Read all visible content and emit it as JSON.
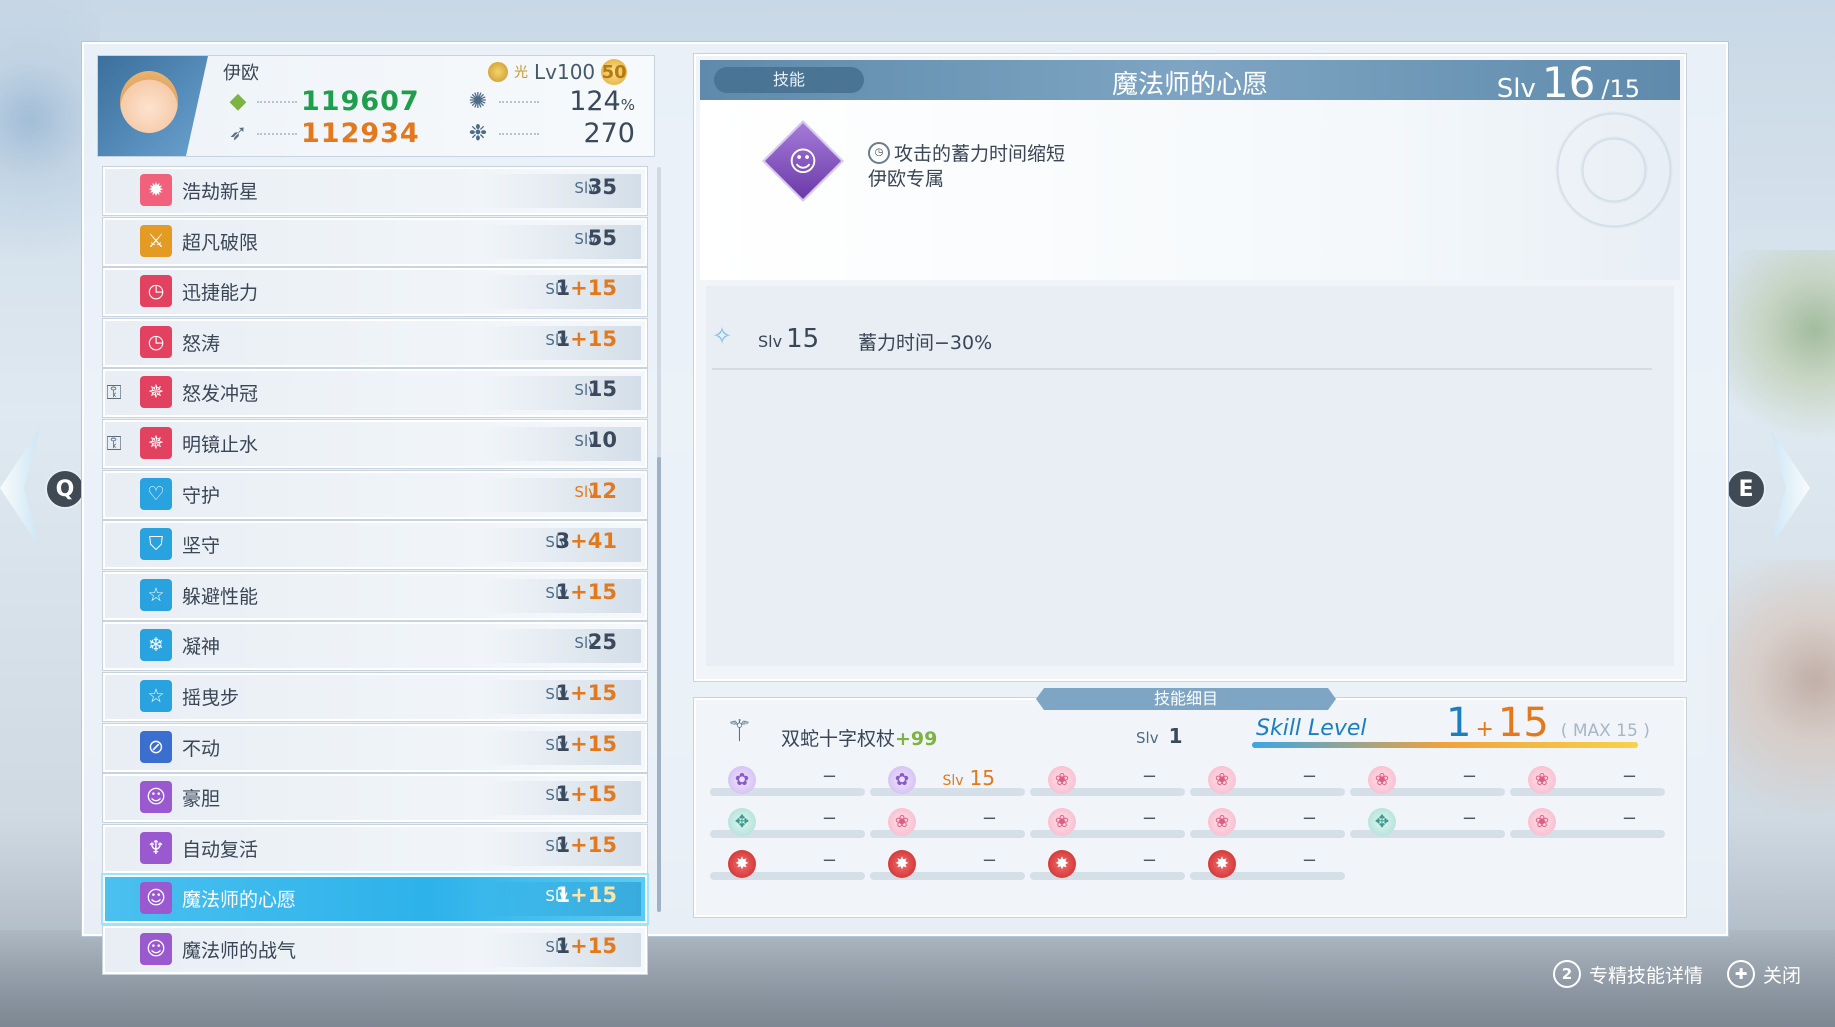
{
  "character": {
    "name": "伊欧",
    "element": "光",
    "level_label": "Lv100",
    "level_badge": "50",
    "hp": "119607",
    "atk": "112934",
    "stat3": "124",
    "stat3_unit": "%",
    "stat4": "270"
  },
  "skills": [
    {
      "name": "浩劫新星",
      "slv_label": "Slv",
      "base": "35",
      "bonus": "",
      "icon": "nova-icon",
      "color": "#f0627b",
      "locked": false
    },
    {
      "name": "超凡破限",
      "slv_label": "Slv",
      "base": "55",
      "bonus": "",
      "icon": "sword-icon",
      "color": "#e39b24",
      "locked": false
    },
    {
      "name": "迅捷能力",
      "slv_label": "Slv",
      "base": "1",
      "bonus": "+15",
      "icon": "clock-icon",
      "color": "#e2425f",
      "locked": false
    },
    {
      "name": "怒涛",
      "slv_label": "Slv",
      "base": "1",
      "bonus": "+15",
      "icon": "clock-icon",
      "color": "#e2425f",
      "locked": false
    },
    {
      "name": "怒发冲冠",
      "slv_label": "Slv",
      "base": "15",
      "bonus": "",
      "icon": "burst-icon",
      "color": "#e2425f",
      "locked": true
    },
    {
      "name": "明镜止水",
      "slv_label": "Slv",
      "base": "10",
      "bonus": "",
      "icon": "burst-icon",
      "color": "#e2425f",
      "locked": true
    },
    {
      "name": "守护",
      "slv_label": "Slv",
      "base": "12",
      "bonus": "",
      "icon": "heart-icon",
      "color": "#29a3e0",
      "locked": false,
      "orange": true
    },
    {
      "name": "坚守",
      "slv_label": "Slv",
      "base": "3",
      "bonus": "+41",
      "icon": "shield-icon",
      "color": "#29a3e0",
      "locked": false
    },
    {
      "name": "躲避性能",
      "slv_label": "Slv",
      "base": "1",
      "bonus": "+15",
      "icon": "star-icon",
      "color": "#29a3e0",
      "locked": false
    },
    {
      "name": "凝神",
      "slv_label": "Slv",
      "base": "25",
      "bonus": "",
      "icon": "snowflake-icon",
      "color": "#29a3e0",
      "locked": false
    },
    {
      "name": "摇曳步",
      "slv_label": "Slv",
      "base": "1",
      "bonus": "+15",
      "icon": "star-icon",
      "color": "#29a3e0",
      "locked": false
    },
    {
      "name": "不动",
      "slv_label": "Slv",
      "base": "1",
      "bonus": "+15",
      "icon": "rune-icon",
      "color": "#3b6fcf",
      "locked": false
    },
    {
      "name": "豪胆",
      "slv_label": "Slv",
      "base": "1",
      "bonus": "+15",
      "icon": "face-icon",
      "color": "#9b59d0",
      "locked": false
    },
    {
      "name": "自动复活",
      "slv_label": "Slv",
      "base": "1",
      "bonus": "+15",
      "icon": "angel-icon",
      "color": "#9b59d0",
      "locked": false
    },
    {
      "name": "魔法师的心愿",
      "slv_label": "Slv",
      "base": "1",
      "bonus": "+15",
      "icon": "wish-icon",
      "color": "#9b59d0",
      "locked": false,
      "selected": true
    },
    {
      "name": "魔法师的战气",
      "slv_label": "Slv",
      "base": "1",
      "bonus": "+15",
      "icon": "wish-icon",
      "color": "#9b59d0",
      "locked": false
    }
  ],
  "detail": {
    "tag": "技能",
    "title": "魔法师的心愿",
    "slv_label": "Slv",
    "slv_current": "16",
    "slv_max": "/15",
    "desc_line1": "攻击的蓄力时间缩短",
    "desc_line2": "伊欧专属",
    "effect_slv_label": "Slv",
    "effect_slv_value": "15",
    "effect_text": "蓄力时间−30%"
  },
  "sub_panel": {
    "tab": "技能细目",
    "weapon_name": "双蛇十字权杖",
    "weapon_plus": "+99",
    "weapon_slv_label": "Slv",
    "weapon_slv_value": "1",
    "skill_level_label": "Skill Level",
    "level_base": "1",
    "level_plus": "+",
    "level_bonus": "15",
    "level_max": "( MAX 15 )",
    "level_fraction": 1.0,
    "slots": [
      [
        {
          "icon": "purple",
          "val": "−"
        },
        {
          "icon": "purple",
          "slv": "Slv",
          "num": "15"
        },
        {
          "icon": "pink",
          "val": "−"
        },
        {
          "icon": "pink",
          "val": "−"
        },
        {
          "icon": "pink",
          "val": "−"
        },
        {
          "icon": "pink",
          "val": "−"
        }
      ],
      [
        {
          "icon": "teal",
          "val": "−"
        },
        {
          "icon": "pink",
          "val": "−"
        },
        {
          "icon": "pink",
          "val": "−"
        },
        {
          "icon": "pink",
          "val": "−"
        },
        {
          "icon": "teal",
          "val": "−"
        },
        {
          "icon": "pink",
          "val": "−"
        }
      ],
      [
        {
          "icon": "red",
          "val": "−"
        },
        {
          "icon": "red",
          "val": "−"
        },
        {
          "icon": "red",
          "val": "−"
        },
        {
          "icon": "red",
          "val": "−"
        }
      ]
    ]
  },
  "nav": {
    "left_key": "Q",
    "right_key": "E"
  },
  "prompts": [
    {
      "key": "2",
      "label": "专精技能详情"
    },
    {
      "key": "✚",
      "label": "关闭"
    }
  ]
}
